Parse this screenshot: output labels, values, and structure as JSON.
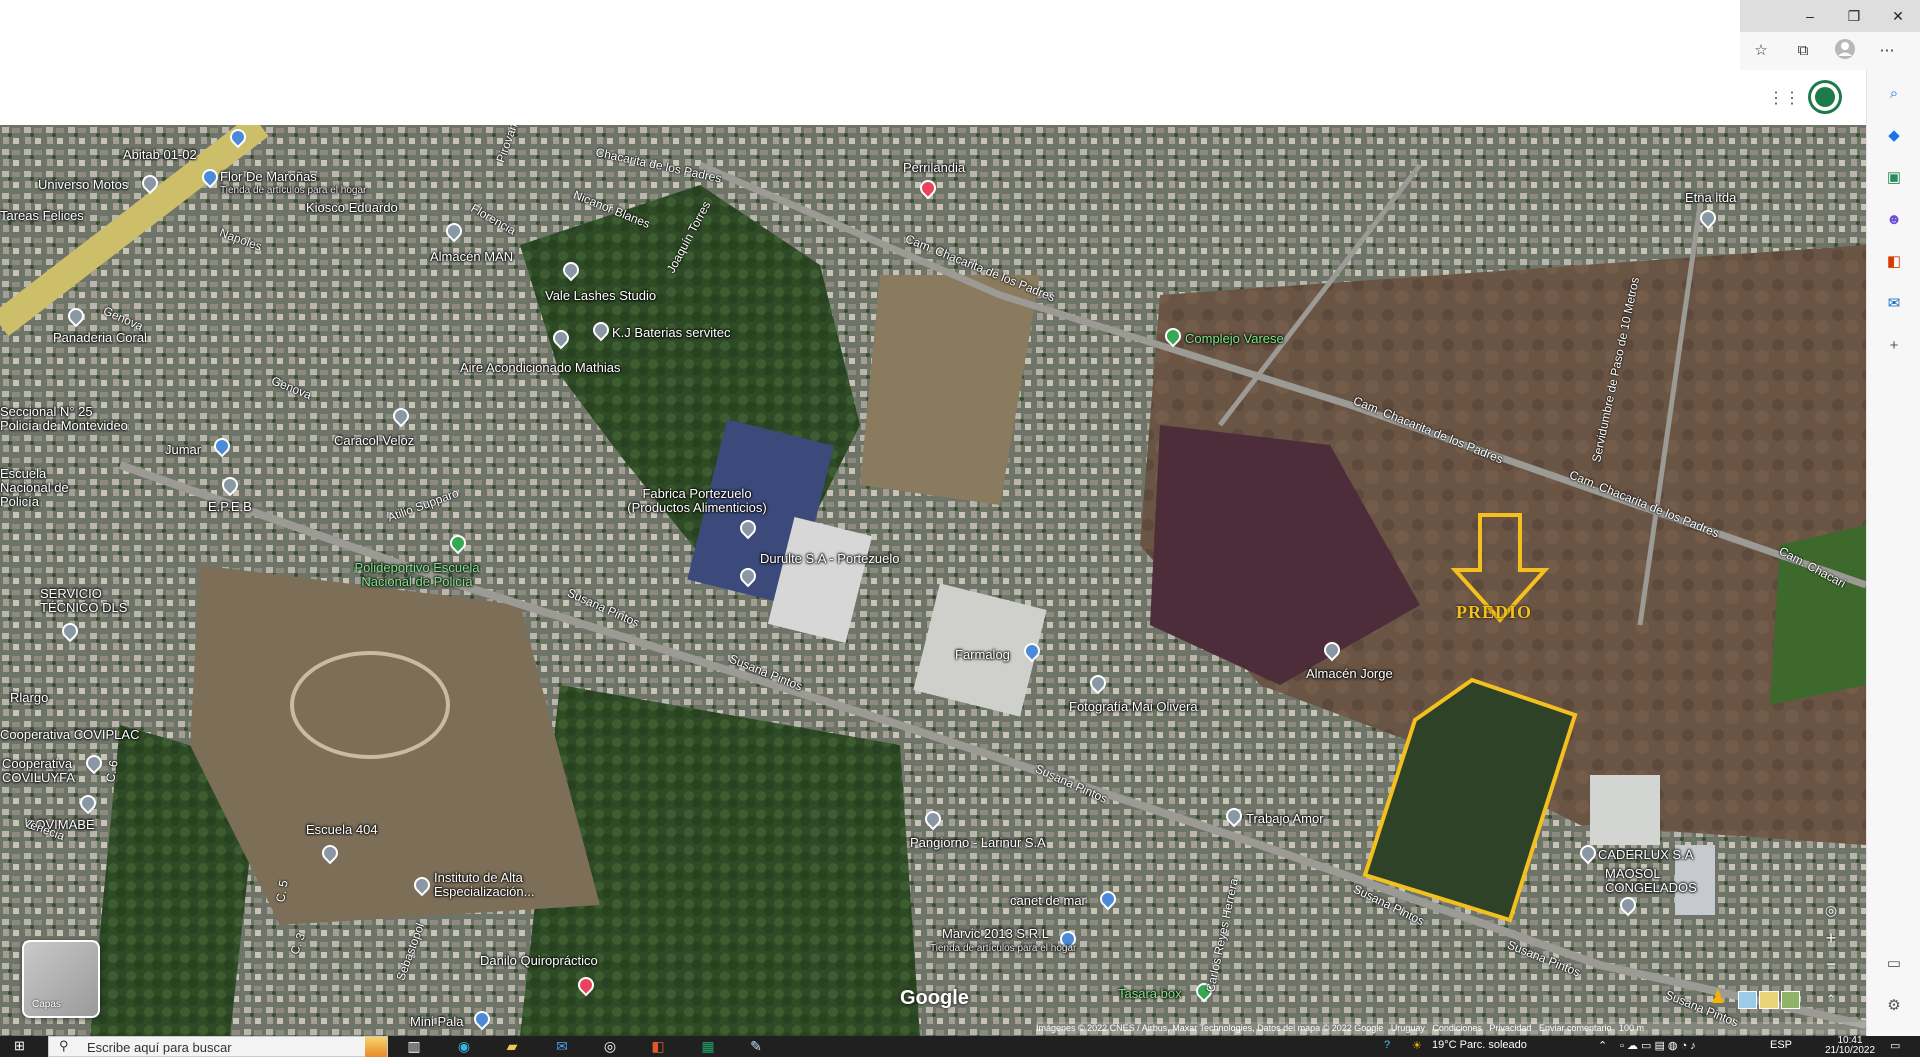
{
  "browser": {
    "window_controls": {
      "minimize": "–",
      "restore": "❐",
      "close": "✕"
    },
    "toolbar_icons": [
      "favorites-star-icon",
      "collections-icon",
      "profile-avatar-icon",
      "more-options-icon"
    ],
    "sidebar_icons": [
      "search-icon",
      "tag-icon",
      "briefcase-icon",
      "people-icon",
      "office-icon",
      "outlook-icon",
      "add-icon"
    ],
    "sidebar_bottom_icons": [
      "split-view-icon",
      "settings-icon"
    ]
  },
  "map": {
    "annotation": {
      "label": "PREDIO",
      "color": "#f3c01e"
    },
    "places": [
      {
        "name": "Abitab 01-02",
        "pin": "blue"
      },
      {
        "name": "Flor De Maroñas",
        "pin": "blue"
      },
      {
        "name": "Tienda de artículos para el hogar",
        "pin": ""
      },
      {
        "name": "Kiosco Eduardo",
        "pin": "grey"
      },
      {
        "name": "Universo Motos",
        "pin": "grey"
      },
      {
        "name": "Tareas Felices",
        "pin": ""
      },
      {
        "name": "Almacén MAN",
        "pin": "grey"
      },
      {
        "name": "Perrilandia",
        "pin": "red"
      },
      {
        "name": "Etna ltda",
        "pin": "grey"
      },
      {
        "name": "Vale Lashes Studio",
        "pin": "grey"
      },
      {
        "name": "K.J Baterias servitec",
        "pin": "grey"
      },
      {
        "name": "Panaderia Coral",
        "pin": "grey"
      },
      {
        "name": "Aire Acondicionado Mathias",
        "pin": "grey"
      },
      {
        "name": "Complejo Varese",
        "pin": "green"
      },
      {
        "name": "Caracol Veloz",
        "pin": "grey"
      },
      {
        "name": "Jumar",
        "pin": "blue"
      },
      {
        "name": "Seccional N° 25 Policía de Montevideo",
        "pin": ""
      },
      {
        "name": "Escuela Nacional de Policía",
        "pin": ""
      },
      {
        "name": "E.P.E.B",
        "pin": "grey"
      },
      {
        "name": "Fabrica Portezuelo (Productos Alimenticios)",
        "pin": "grey"
      },
      {
        "name": "Durulte S.A - Portezuelo",
        "pin": "grey"
      },
      {
        "name": "Polideportivo Escuela Nacional de Policía",
        "pin": "green"
      },
      {
        "name": "SERVICIO TÉCNICO DLS",
        "pin": "grey"
      },
      {
        "name": "Farmalog",
        "pin": "blue"
      },
      {
        "name": "Almacén Jorge",
        "pin": "grey"
      },
      {
        "name": "Fotografía Mai Olivera",
        "pin": "grey"
      },
      {
        "name": "Rlargo",
        "pin": ""
      },
      {
        "name": "Cooperativa COVIPLAC",
        "pin": ""
      },
      {
        "name": "Cooperativa COVILUYFA",
        "pin": "grey"
      },
      {
        "name": "COVIMABE",
        "pin": "grey"
      },
      {
        "name": "Trabajo Amor",
        "pin": "grey"
      },
      {
        "name": "Pangiorno - Larinur S.A",
        "pin": "grey"
      },
      {
        "name": "CADERLUX S.A",
        "pin": "grey"
      },
      {
        "name": "MAOSOL CONGELADOS",
        "pin": "grey"
      },
      {
        "name": "Escuela 404",
        "pin": "grey"
      },
      {
        "name": "Instituto de Alta Especialización...",
        "pin": "grey"
      },
      {
        "name": "canet de mar",
        "pin": "blue"
      },
      {
        "name": "Marvic 2013 S.R.L",
        "pin": "blue"
      },
      {
        "name": "Tienda de artículos para el hogar",
        "pin": ""
      },
      {
        "name": "Danilo Quiropráctico",
        "pin": "red"
      },
      {
        "name": "Mini Pala",
        "pin": "blue"
      },
      {
        "name": "Tasara box",
        "pin": "green"
      }
    ],
    "roads": [
      "Chacarita de los Padres",
      "Nicanor Blanes",
      "Joaquín Torres",
      "Cam. Chacarita de los Padres",
      "Napoles",
      "Florencia",
      "Genova",
      "Genova",
      "Atilio Supparo",
      "Susana Pintos",
      "Susana Pintos",
      "Susana Pintos",
      "Susana Pintos",
      "Susana Pintos",
      "Susana Pintos",
      "Cam. Chacarita de los Padres",
      "Cam. Chacarita de los Padres",
      "Cam. Chacari",
      "Servidumbre de Paso de 10 Metros",
      "Carlos Reyes Herrera",
      "Sebastopol",
      "Venecia",
      "C. 3",
      "C. 5",
      "C. 6",
      "Pirovano"
    ],
    "layers_label": "Capas",
    "google_logo": "Google",
    "attribution": {
      "imagery": "Imágenes © 2022 CNES / Airbus, Maxar Technologies, Datos del mapa © 2022 Google",
      "country": "Uruguay",
      "terms": "Condiciones",
      "privacy": "Privacidad",
      "feedback": "Enviar comentario",
      "scale": "100 m"
    }
  },
  "taskbar": {
    "search_placeholder": "Escribe aquí para buscar",
    "apps": [
      "task-view-icon",
      "edge-icon",
      "file-explorer-icon",
      "mail-icon",
      "app-circle-icon",
      "office-icon",
      "excel-icon",
      "feather-app-icon"
    ],
    "weather": "19°C  Parc. soleado",
    "language": "ESP",
    "time": "10:41",
    "date": "21/10/2022"
  }
}
